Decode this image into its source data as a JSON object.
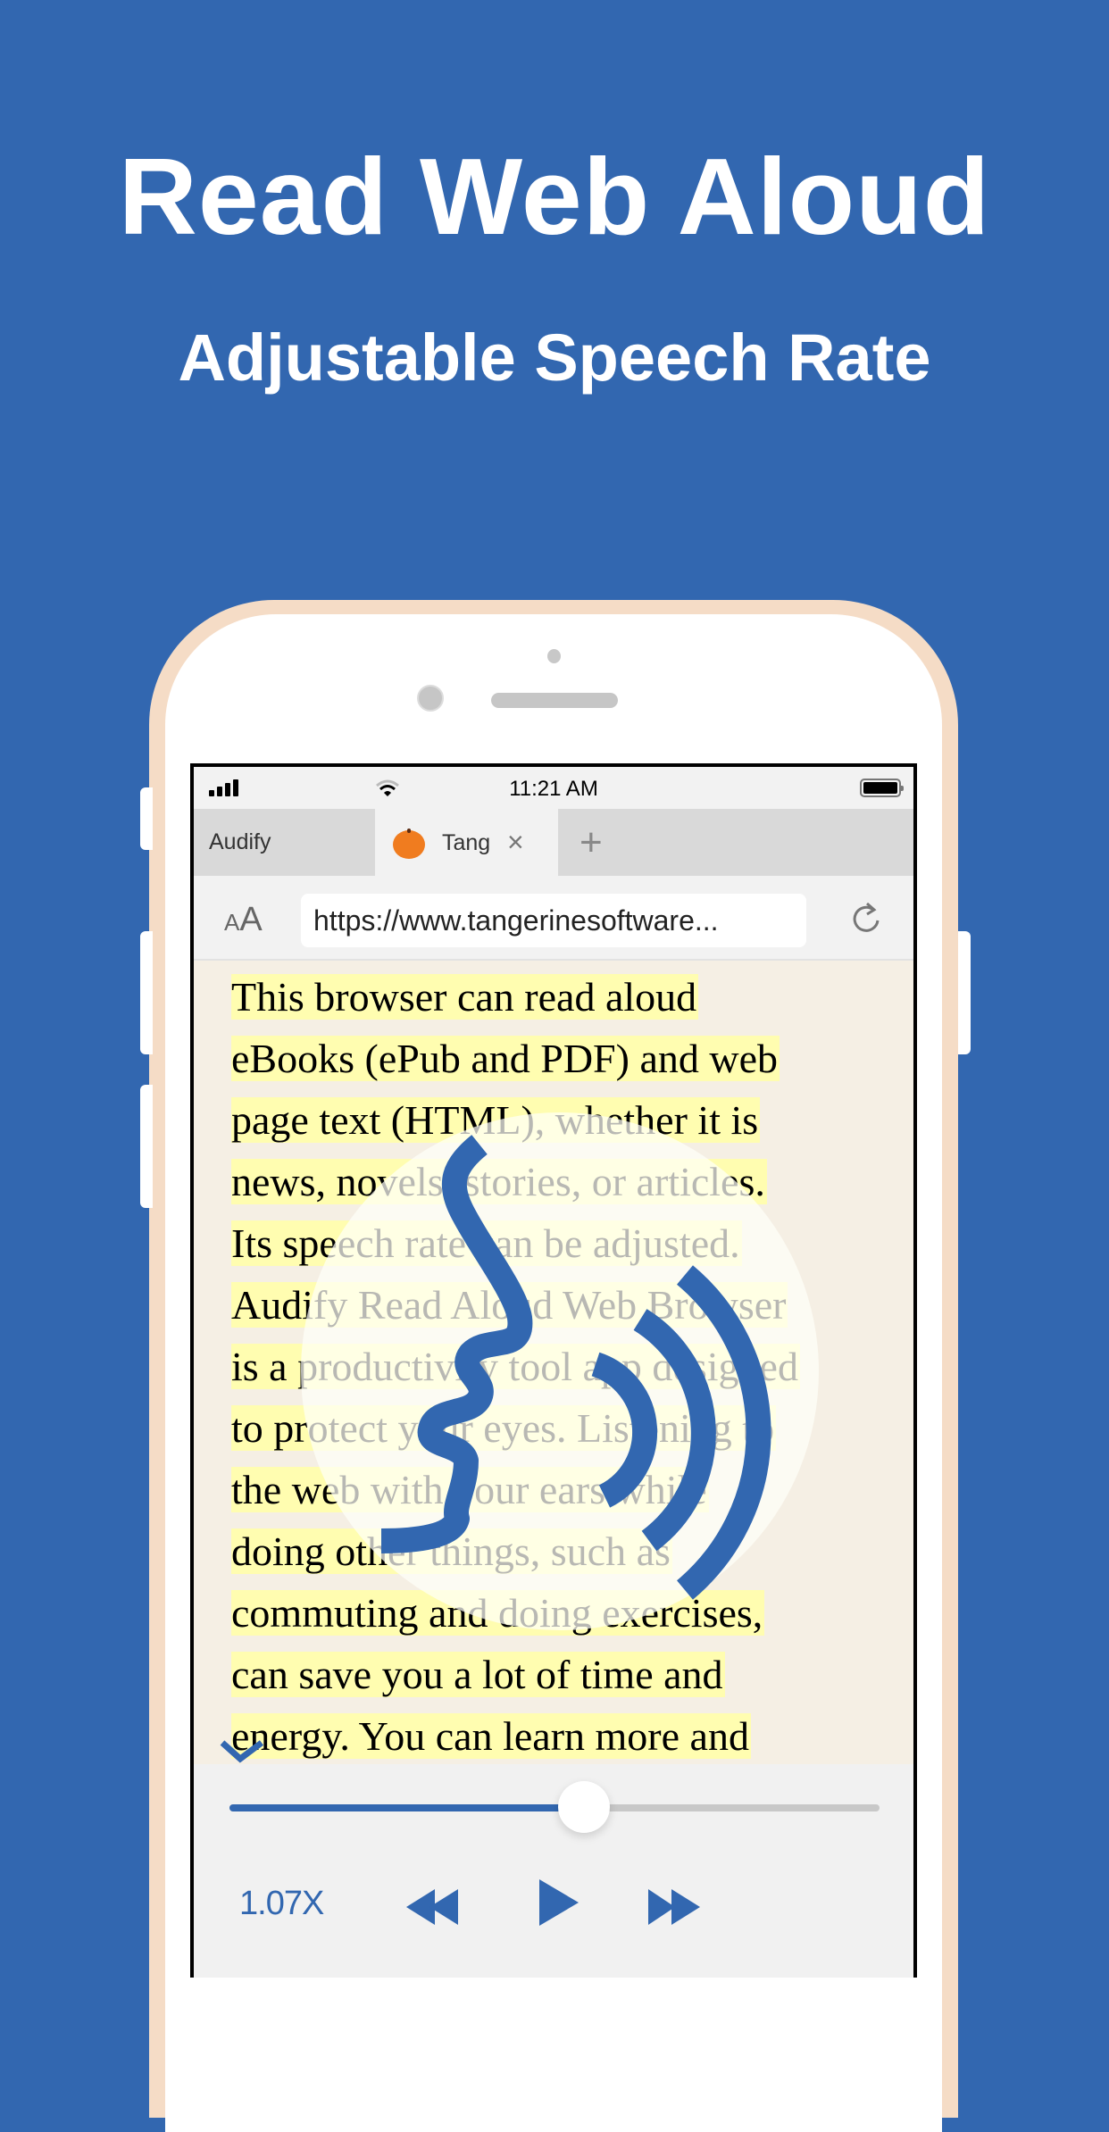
{
  "promo": {
    "headline": "Read Web Aloud",
    "subheadline": "Adjustable Speech Rate"
  },
  "status_bar": {
    "time": "11:21 AM",
    "icons": [
      "signal-icon",
      "wifi-icon",
      "battery-icon"
    ]
  },
  "tabs": [
    {
      "label": "Audify",
      "active": false
    },
    {
      "label": "Tangerine",
      "active": true,
      "icon": "tangerine-favicon",
      "close_label": "×"
    }
  ],
  "new_tab_label": "+",
  "address_bar": {
    "text_size_small": "A",
    "text_size_large": "A",
    "url": "https://www.tangerinesoftware...",
    "reload_icon": "reload-icon"
  },
  "article": {
    "lines": [
      "This browser can read aloud",
      "eBooks (ePub and PDF) and web",
      "page text (HTML), whether it is",
      "news, novels, stories, or articles.",
      "Its speech rate can be adjusted.",
      "Audify Read Aloud Web Browser",
      "is a productivity tool app designed",
      "to protect your eyes. Listening to",
      "the web with your ears while",
      "doing other things, such as",
      "commuting and doing exercises,",
      "can save you a lot of time and",
      "energy. You can learn more and"
    ],
    "highlight_color": "#fffdb0",
    "overlay_icon": "speaking-head-icon"
  },
  "player": {
    "progress": 0.546,
    "rate_label": "1.07X",
    "controls": [
      "rewind-icon",
      "play-icon",
      "fast-forward-icon"
    ],
    "accent_color": "#3267b0"
  },
  "colors": {
    "background": "#3267b0",
    "phone_frame": "#f5dcc6",
    "page_background": "#f5efe4"
  }
}
